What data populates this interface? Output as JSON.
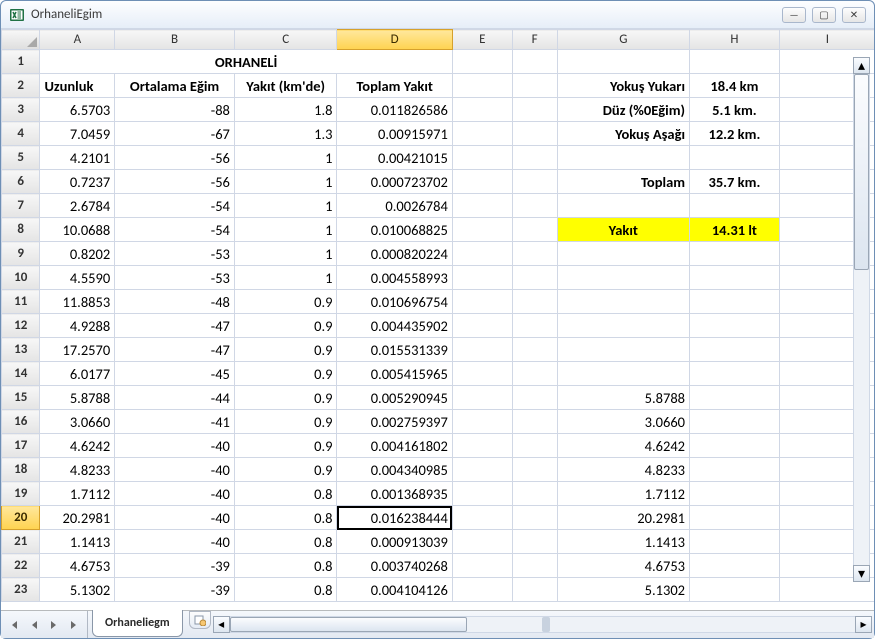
{
  "window": {
    "title": "OrhaneliEgim"
  },
  "columns": [
    "A",
    "B",
    "C",
    "D",
    "E",
    "F",
    "G",
    "H",
    "I"
  ],
  "header_row_span": 4,
  "title_cell": "ORHANELİ",
  "headers": {
    "A": "Uzunluk",
    "B": "Ortalama Eğim",
    "C": "Yakıt (km'de)",
    "D": "Toplam Yakıt"
  },
  "summary": {
    "items": [
      {
        "label": "Yokuş Yukarı",
        "value": "18.4 km"
      },
      {
        "label": "Düz (%0Eğim)",
        "value": "5.1 km."
      },
      {
        "label": "Yokuş Aşağı",
        "value": "12.2 km."
      },
      {
        "label": "",
        "value": ""
      },
      {
        "label": "Toplam",
        "value": "35.7 km."
      },
      {
        "label": "",
        "value": ""
      },
      {
        "label": "Yakıt",
        "value": "14.31 lt",
        "highlight": true
      }
    ]
  },
  "rows": [
    {
      "n": 3,
      "A": "6.5703",
      "B": "-88",
      "C": "1.8",
      "D": "0.011826586",
      "G": ""
    },
    {
      "n": 4,
      "A": "7.0459",
      "B": "-67",
      "C": "1.3",
      "D": "0.00915971",
      "G": ""
    },
    {
      "n": 5,
      "A": "4.2101",
      "B": "-56",
      "C": "1",
      "D": "0.00421015",
      "G": ""
    },
    {
      "n": 6,
      "A": "0.7237",
      "B": "-56",
      "C": "1",
      "D": "0.000723702",
      "G": ""
    },
    {
      "n": 7,
      "A": "2.6784",
      "B": "-54",
      "C": "1",
      "D": "0.0026784",
      "G": ""
    },
    {
      "n": 8,
      "A": "10.0688",
      "B": "-54",
      "C": "1",
      "D": "0.010068825",
      "G": ""
    },
    {
      "n": 9,
      "A": "0.8202",
      "B": "-53",
      "C": "1",
      "D": "0.000820224",
      "G": ""
    },
    {
      "n": 10,
      "A": "4.5590",
      "B": "-53",
      "C": "1",
      "D": "0.004558993",
      "G": ""
    },
    {
      "n": 11,
      "A": "11.8853",
      "B": "-48",
      "C": "0.9",
      "D": "0.010696754",
      "G": ""
    },
    {
      "n": 12,
      "A": "4.9288",
      "B": "-47",
      "C": "0.9",
      "D": "0.004435902",
      "G": ""
    },
    {
      "n": 13,
      "A": "17.2570",
      "B": "-47",
      "C": "0.9",
      "D": "0.015531339",
      "G": ""
    },
    {
      "n": 14,
      "A": "6.0177",
      "B": "-45",
      "C": "0.9",
      "D": "0.005415965",
      "G": ""
    },
    {
      "n": 15,
      "A": "5.8788",
      "B": "-44",
      "C": "0.9",
      "D": "0.005290945",
      "G": "5.8788"
    },
    {
      "n": 16,
      "A": "3.0660",
      "B": "-41",
      "C": "0.9",
      "D": "0.002759397",
      "G": "3.0660"
    },
    {
      "n": 17,
      "A": "4.6242",
      "B": "-40",
      "C": "0.9",
      "D": "0.004161802",
      "G": "4.6242"
    },
    {
      "n": 18,
      "A": "4.8233",
      "B": "-40",
      "C": "0.9",
      "D": "0.004340985",
      "G": "4.8233"
    },
    {
      "n": 19,
      "A": "1.7112",
      "B": "-40",
      "C": "0.8",
      "D": "0.001368935",
      "G": "1.7112"
    },
    {
      "n": 20,
      "A": "20.2981",
      "B": "-40",
      "C": "0.8",
      "D": "0.016238444",
      "G": "20.2981",
      "active": "D"
    },
    {
      "n": 21,
      "A": "1.1413",
      "B": "-40",
      "C": "0.8",
      "D": "0.000913039",
      "G": "1.1413"
    },
    {
      "n": 22,
      "A": "4.6753",
      "B": "-39",
      "C": "0.8",
      "D": "0.003740268",
      "G": "4.6753"
    },
    {
      "n": 23,
      "A": "5.1302",
      "B": "-39",
      "C": "0.8",
      "D": "0.004104126",
      "G": "5.1302"
    }
  ],
  "active_cell": {
    "row": 20,
    "col": "D"
  },
  "sheet_tab": "Orhaneliegm"
}
